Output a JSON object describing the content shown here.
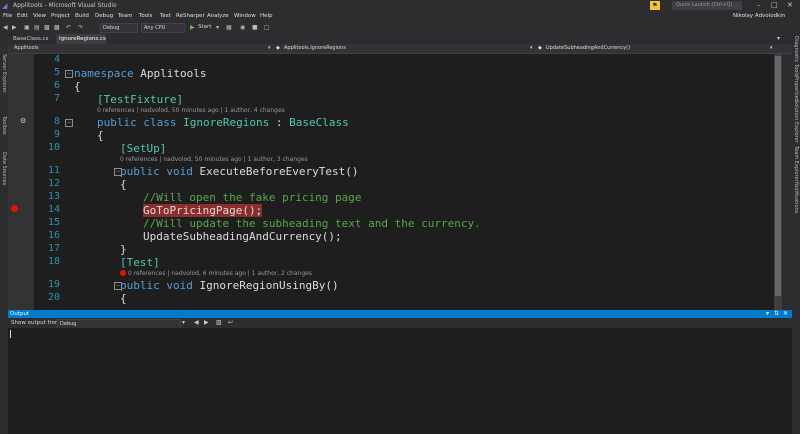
{
  "window": {
    "title": "Applitools - Microsoft Visual Studio",
    "quick_launch_placeholder": "Quick Launch (Ctrl+Q)",
    "user": "Nikolay Advolodkin",
    "notification_icon": "flag-icon"
  },
  "menu": [
    "File",
    "Edit",
    "View",
    "Project",
    "Build",
    "Debug",
    "Team",
    "Tools",
    "Test",
    "ReSharper",
    "Analyze",
    "Window",
    "Help"
  ],
  "toolbar": {
    "configuration": "Debug",
    "platform": "Any CPU",
    "start_label": "Start"
  },
  "tabs": [
    "BaseClass.cs",
    "IgnoreRegions.cs"
  ],
  "navbar": {
    "project": "Applitools",
    "class": "Applitools.IgnoreRegions",
    "member": "UpdateSubheadingAndCurrency()"
  },
  "left_rail": [
    "Server Explorer",
    "Toolbox",
    "Data Sources"
  ],
  "right_rail": [
    "Diagnostic Tools",
    "Properties",
    "Solution Explorer",
    "Team Explorer",
    "Notifications"
  ],
  "editor": {
    "lines": [
      {
        "n": "4",
        "text": ""
      },
      {
        "n": "5",
        "text": "namespace Applitools"
      },
      {
        "n": "6",
        "text": "{"
      },
      {
        "n": "7",
        "text": "[TestFixture]",
        "lens": "0 references | nadvolod, 50 minutes ago | 1 author, 4 changes"
      },
      {
        "n": "8",
        "text": "public class IgnoreRegions : BaseClass"
      },
      {
        "n": "9",
        "text": "{"
      },
      {
        "n": "10",
        "text": "[SetUp]",
        "lens": "0 references | nadvolod, 50 minutes ago | 1 author, 3 changes"
      },
      {
        "n": "11",
        "text": "public void ExecuteBeforeEveryTest()"
      },
      {
        "n": "12",
        "text": "{"
      },
      {
        "n": "13",
        "text": "//Will open the fake pricing page"
      },
      {
        "n": "14",
        "text": "GoToPricingPage();"
      },
      {
        "n": "15",
        "text": "//Will update the subheading text and the currency."
      },
      {
        "n": "16",
        "text": "UpdateSubheadingAndCurrency();"
      },
      {
        "n": "17",
        "text": "}"
      },
      {
        "n": "18",
        "text": "[Test]",
        "lens": "0 references | nadvolod, 6 minutes ago | 1 author, 2 changes"
      },
      {
        "n": "19",
        "text": "public void IgnoreRegionUsingBy()"
      },
      {
        "n": "20",
        "text": "{"
      }
    ]
  },
  "output": {
    "title": "Output",
    "show_from_label": "Show output from:",
    "source": "Debug"
  },
  "colors": {
    "accent": "#007acc",
    "keyword": "#569cd6",
    "type": "#4ec9b0",
    "comment": "#57a64a",
    "breakpoint": "#e51400",
    "line_number": "#2b91af"
  }
}
